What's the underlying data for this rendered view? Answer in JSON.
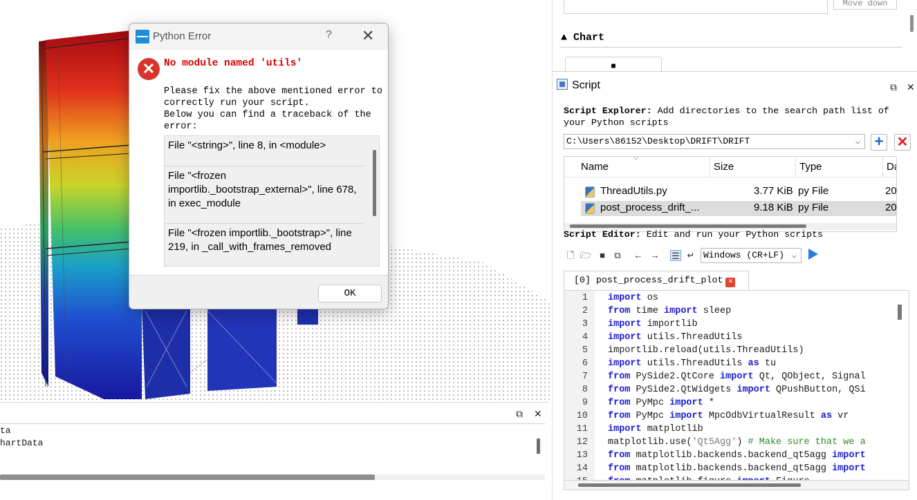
{
  "dialog": {
    "title": "Python Error",
    "help_glyph": "?",
    "close_glyph": "✕",
    "error_heading": "No module named 'utils'",
    "message": "Please fix the above mentioned error to correctly run your script.\nBelow you can find a traceback of the error:",
    "traceback": [
      "File \"<string>\", line 8, in <module>",
      "File \"<frozen importlib._bootstrap_external>\", line 678, in exec_module",
      "File \"<frozen importlib._bootstrap>\", line 219, in _call_with_frames_removed"
    ],
    "ok_label": "OK"
  },
  "console": {
    "float_glyph": "⧉",
    "close_glyph": "✕",
    "lines": [
      "ta",
      "hartData"
    ]
  },
  "top_panel": {
    "move_down_label": "Move down",
    "chart_title": "▲ Chart"
  },
  "script_panel": {
    "title": "Script",
    "float_glyph": "⧉",
    "close_glyph": "✕",
    "explorer_label": "Script Explorer:",
    "explorer_desc": " Add directories to the search path list of your Python scripts",
    "path_value": "C:\\Users\\86152\\Desktop\\DRIFT\\DRIFT",
    "add_glyph": "+",
    "remove_glyph": "✕",
    "columns": [
      "Name",
      "Size",
      "Type",
      "Da"
    ],
    "files": [
      {
        "name": "ThreadUtils.py",
        "size": "3.77 KiB",
        "type": "py File",
        "date": "20"
      },
      {
        "name": "post_process_drift_...",
        "size": "9.18 KiB",
        "type": "py File",
        "date": "20"
      }
    ],
    "editor_label": "Script Editor:",
    "editor_desc": " Edit and run your Python scripts",
    "eol_value": "Windows (CR+LF)",
    "tab_label": "[0] post_process_drift_plot",
    "tab_close_glyph": "✕"
  },
  "code": [
    {
      "n": "1",
      "parts": [
        [
          "kw",
          "import"
        ],
        [
          "t",
          " os"
        ]
      ]
    },
    {
      "n": "2",
      "parts": [
        [
          "kw",
          "from"
        ],
        [
          "t",
          " time "
        ],
        [
          "kw",
          "import"
        ],
        [
          "t",
          " sleep"
        ]
      ]
    },
    {
      "n": "3",
      "parts": [
        [
          "kw",
          "import"
        ],
        [
          "t",
          " importlib"
        ]
      ]
    },
    {
      "n": "4",
      "parts": [
        [
          "kw",
          "import"
        ],
        [
          "t",
          " utils.ThreadUtils"
        ]
      ]
    },
    {
      "n": "5",
      "parts": [
        [
          "t",
          "importlib.reload(utils.ThreadUtils)"
        ]
      ]
    },
    {
      "n": "6",
      "parts": [
        [
          "kw",
          "import"
        ],
        [
          "t",
          " utils.ThreadUtils "
        ],
        [
          "kw",
          "as"
        ],
        [
          "t",
          " tu"
        ]
      ]
    },
    {
      "n": "7",
      "parts": [
        [
          "kw",
          "from"
        ],
        [
          "t",
          " PySide2.QtCore "
        ],
        [
          "kw",
          "import"
        ],
        [
          "t",
          " Qt, QObject, Signal"
        ]
      ]
    },
    {
      "n": "8",
      "parts": [
        [
          "kw",
          "from"
        ],
        [
          "t",
          " PySide2.QtWidgets "
        ],
        [
          "kw",
          "import"
        ],
        [
          "t",
          " QPushButton, QSi"
        ]
      ]
    },
    {
      "n": "9",
      "parts": [
        [
          "kw",
          "from"
        ],
        [
          "t",
          " PyMpc "
        ],
        [
          "kw",
          "import"
        ],
        [
          "t",
          " *"
        ]
      ]
    },
    {
      "n": "10",
      "parts": [
        [
          "kw",
          "from"
        ],
        [
          "t",
          " PyMpc "
        ],
        [
          "kw",
          "import"
        ],
        [
          "t",
          " MpcOdbVirtualResult "
        ],
        [
          "kw",
          "as"
        ],
        [
          "t",
          " vr"
        ]
      ]
    },
    {
      "n": "11",
      "parts": [
        [
          "kw",
          "import"
        ],
        [
          "t",
          " matplotlib"
        ]
      ]
    },
    {
      "n": "12",
      "parts": [
        [
          "t",
          "matplotlib.use("
        ],
        [
          "st",
          "'Qt5Agg'"
        ],
        [
          "t",
          ") "
        ],
        [
          "cm",
          "# Make sure that we a"
        ]
      ]
    },
    {
      "n": "13",
      "parts": [
        [
          "kw",
          "from"
        ],
        [
          "t",
          " matplotlib.backends.backend_qt5agg "
        ],
        [
          "kw",
          "import"
        ]
      ]
    },
    {
      "n": "14",
      "parts": [
        [
          "kw",
          "from"
        ],
        [
          "t",
          " matplotlib.backends.backend_qt5agg "
        ],
        [
          "kw",
          "import"
        ]
      ]
    },
    {
      "n": "15",
      "parts": [
        [
          "kw",
          "from"
        ],
        [
          "t",
          " matplotlib.figure "
        ],
        [
          "kw",
          "import"
        ],
        [
          "t",
          " Figure"
        ]
      ]
    }
  ]
}
